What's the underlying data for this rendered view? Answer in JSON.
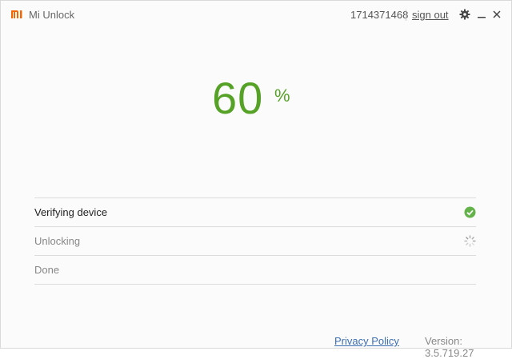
{
  "app": {
    "title": "Mi Unlock",
    "brand_color": "#f56600"
  },
  "header": {
    "account_id": "1714371468",
    "sign_out_label": "sign out",
    "icons": [
      "gear-icon",
      "minimize-icon",
      "close-icon"
    ]
  },
  "progress": {
    "value": "60",
    "unit": "%",
    "color": "#56a227"
  },
  "steps": [
    {
      "label": "Verifying device",
      "status": "done",
      "icon": "check-circle-icon"
    },
    {
      "label": "Unlocking",
      "status": "in-progress",
      "icon": "spinner-icon"
    },
    {
      "label": "Done",
      "status": "pending",
      "icon": ""
    }
  ],
  "footer": {
    "privacy_label": "Privacy Policy",
    "version": "Version: 3.5.719.27"
  }
}
